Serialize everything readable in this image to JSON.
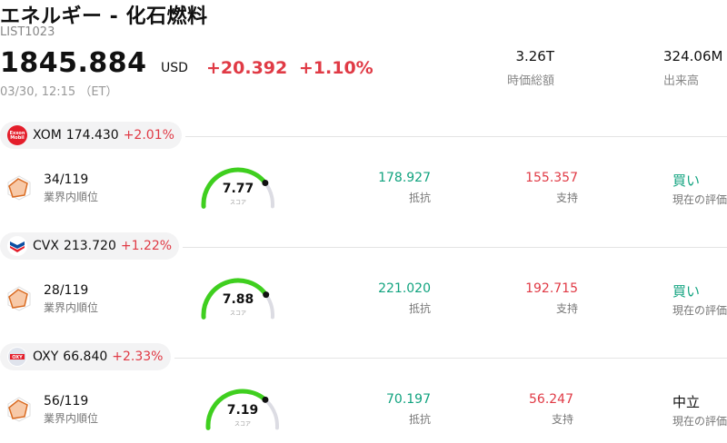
{
  "header": {
    "title": "エネルギー - 化石燃料",
    "code": "LIST1023",
    "price": "1845.884",
    "currency": "USD",
    "change": "+20.392",
    "change_pct": "+1.10%",
    "time": "03/30, 12:15 （ET）",
    "market_cap_value": "3.26T",
    "market_cap_label": "時価総額",
    "volume_value": "324.06M",
    "volume_label": "出来高"
  },
  "rows": [
    {
      "symbol": "XOM",
      "price": "174.430",
      "change_pct": "+2.01%",
      "logo_text": "Exxon Mobil",
      "logo_color": "#e41e2b",
      "rank": "34/119",
      "rank_label": "業界内順位",
      "score": "7.77",
      "score_value": 7.77,
      "score_label": "スコア",
      "resistance": "178.927",
      "resistance_label": "抵抗",
      "support": "155.357",
      "support_label": "支持",
      "evaluation": "買い",
      "evaluation_label": "現在の評価",
      "evaluation_color": "#11a37f"
    },
    {
      "symbol": "CVX",
      "price": "213.720",
      "change_pct": "+1.22%",
      "logo_text": "",
      "logo_color": "#0a4ea2",
      "rank": "28/119",
      "rank_label": "業界内順位",
      "score": "7.88",
      "score_value": 7.88,
      "score_label": "スコア",
      "resistance": "221.020",
      "resistance_label": "抵抗",
      "support": "192.715",
      "support_label": "支持",
      "evaluation": "買い",
      "evaluation_label": "現在の評価",
      "evaluation_color": "#11a37f"
    },
    {
      "symbol": "OXY",
      "price": "66.840",
      "change_pct": "+2.33%",
      "logo_text": "OXY",
      "logo_color": "#d7dbe6",
      "rank": "56/119",
      "rank_label": "業界内順位",
      "score": "7.19",
      "score_value": 7.19,
      "score_label": "スコア",
      "resistance": "70.197",
      "resistance_label": "抵抗",
      "support": "56.247",
      "support_label": "支持",
      "evaluation": "中立",
      "evaluation_label": "現在の評価",
      "evaluation_color": "#111111"
    }
  ],
  "colors": {
    "up_red": "#e03a45",
    "resistance_green": "#11a37f",
    "gauge_green": "#3fcf1f",
    "gauge_track": "#dcdce3"
  }
}
